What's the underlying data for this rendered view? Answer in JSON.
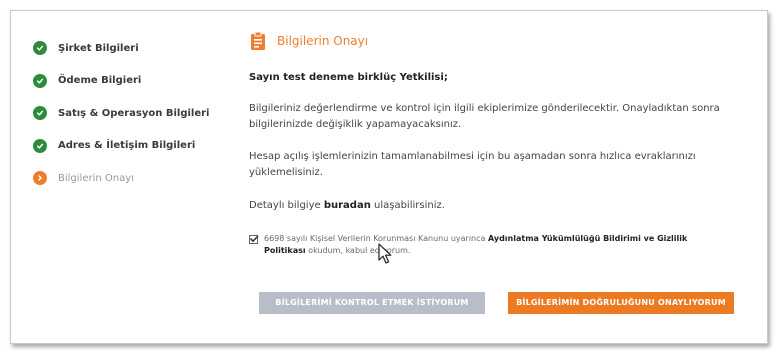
{
  "stepper": {
    "steps": [
      {
        "label": "Şirket Bilgileri",
        "status": "done"
      },
      {
        "label": "Ödeme Bilgieri",
        "status": "done"
      },
      {
        "label": "Satış & Operasyon Bilgileri",
        "status": "done"
      },
      {
        "label": "Adres & İletişim Bilgileri",
        "status": "done"
      },
      {
        "label": "Bilgilerin Onayı",
        "status": "active"
      }
    ]
  },
  "main": {
    "title": "Bilgilerin Onayı",
    "greeting": "Sayın test deneme birklüç Yetkilisi;",
    "paragraph1": "Bilgileriniz değerlendirme ve kontrol için ilgili ekiplerimize gönderilecektir. Onayladıktan sonra bilgilerinizde değişiklik yapamayacaksınız.",
    "paragraph2": "Hesap açılış işlemlerinizin tamamlanabilmesi için bu aşamadan sonra hızlıca evraklarınızı yüklemelisiniz.",
    "detail_prefix": "Detaylı bilgiye ",
    "detail_link": "buradan",
    "detail_suffix": " ulaşabilirsiniz.",
    "consent_prefix": "6698 sayılı Kişisel Verilerin Korunması Kanunu uyarınca ",
    "consent_bold": "Aydınlatma Yükümlülüğü Bildirimi ve Gizlilik Politikası",
    "consent_suffix": " okudum, kabul ediyorum.",
    "consent_checked": true
  },
  "buttons": {
    "check_label": "BİLGİLERİMİ KONTROL ETMEK İSTİYORUM",
    "confirm_label": "BİLGİLERİMİN DOĞRULUĞUNU ONAYLIYORUM"
  },
  "colors": {
    "accent": "#ef7e2c",
    "done": "#2e8b3c",
    "secondary_button": "#b7bec7",
    "primary_button": "#ec7a22"
  },
  "icons": {
    "done": "check-icon",
    "active": "chevron-right-icon",
    "title": "clipboard-icon"
  }
}
